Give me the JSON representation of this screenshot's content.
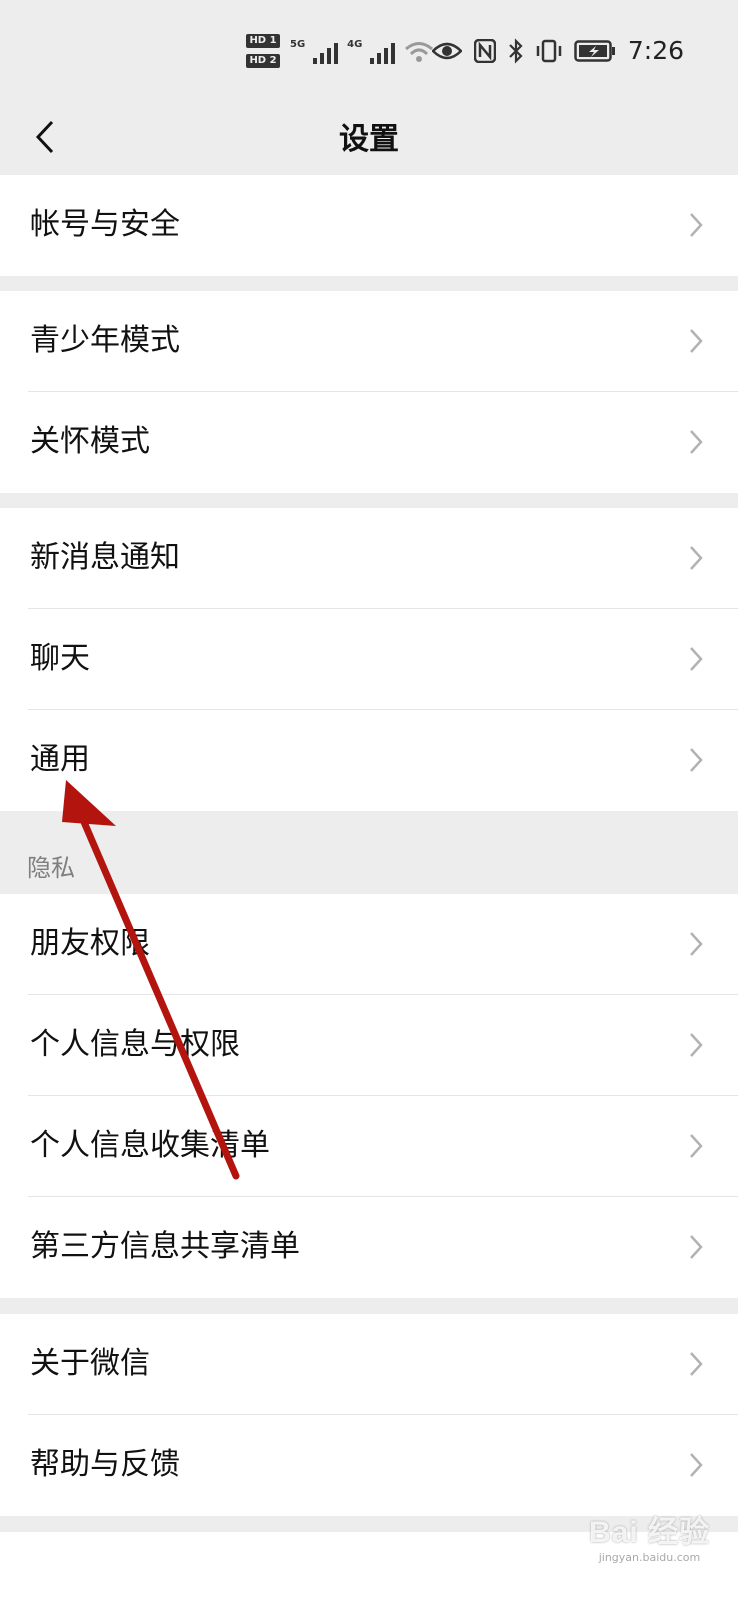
{
  "status_bar": {
    "hd1": "HD 1",
    "hd2": "HD 2",
    "net1": "5G",
    "net2": "4G",
    "time": "7:26"
  },
  "nav": {
    "title": "设置"
  },
  "groups": [
    {
      "items": [
        {
          "label": "帐号与安全"
        }
      ]
    },
    {
      "items": [
        {
          "label": "青少年模式"
        },
        {
          "label": "关怀模式"
        }
      ]
    },
    {
      "items": [
        {
          "label": "新消息通知"
        },
        {
          "label": "聊天"
        },
        {
          "label": "通用"
        }
      ]
    },
    {
      "items": [
        {
          "label": "朋友权限"
        },
        {
          "label": "个人信息与权限"
        },
        {
          "label": "个人信息收集清单"
        },
        {
          "label": "第三方信息共享清单"
        }
      ]
    },
    {
      "items": [
        {
          "label": "关于微信"
        },
        {
          "label": "帮助与反馈"
        }
      ]
    }
  ],
  "privacy_section": {
    "label": "隐私"
  },
  "watermark": {
    "main": "Bai 经验",
    "sub": "jingyan.baidu.com"
  },
  "colors": {
    "background": "#ededed",
    "card": "#ffffff",
    "arrow": "#b3140e",
    "chevron": "#b2b2b2"
  }
}
